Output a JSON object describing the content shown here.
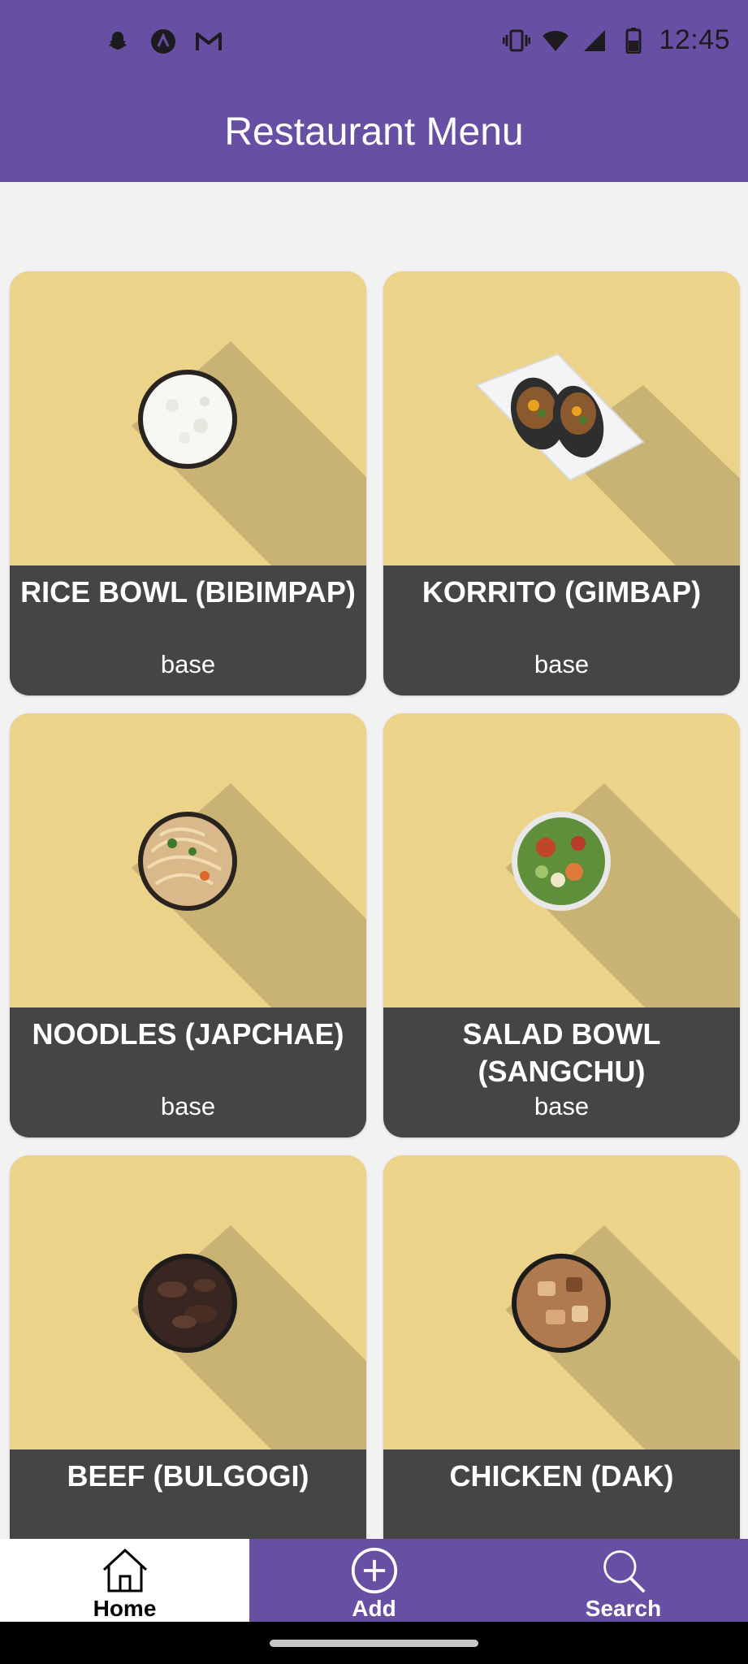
{
  "status_bar": {
    "time": "12:45",
    "left_icons": [
      "snapchat-icon",
      "app-a-icon",
      "gmail-icon"
    ],
    "right_icons": [
      "vibrate-icon",
      "wifi-icon",
      "signal-icon",
      "battery-icon"
    ]
  },
  "app_bar": {
    "title": "Restaurant Menu"
  },
  "menu_items": [
    {
      "title": "RICE BOWL (BIBIMPAP)",
      "subtitle": "base",
      "image": "rice-bowl-image"
    },
    {
      "title": "KORRITO (GIMBAP)",
      "subtitle": "base",
      "image": "korrito-image"
    },
    {
      "title": "NOODLES (JAPCHAE)",
      "subtitle": "base",
      "image": "noodles-image"
    },
    {
      "title": "SALAD BOWL (SANGCHU)",
      "subtitle": "base",
      "image": "salad-bowl-image"
    },
    {
      "title": "BEEF (BULGOGI)",
      "subtitle": "",
      "image": "beef-image"
    },
    {
      "title": "CHICKEN (DAK)",
      "subtitle": "",
      "image": "chicken-image"
    }
  ],
  "bottom_nav": {
    "home_label": "Home",
    "add_label": "Add",
    "search_label": "Search"
  },
  "colors": {
    "primary": "#6750a4",
    "card_image_bg": "#ecd38a",
    "card_shadow": "#c9b374",
    "card_label_bg": "#454545",
    "page_bg": "#f2f2f2"
  }
}
